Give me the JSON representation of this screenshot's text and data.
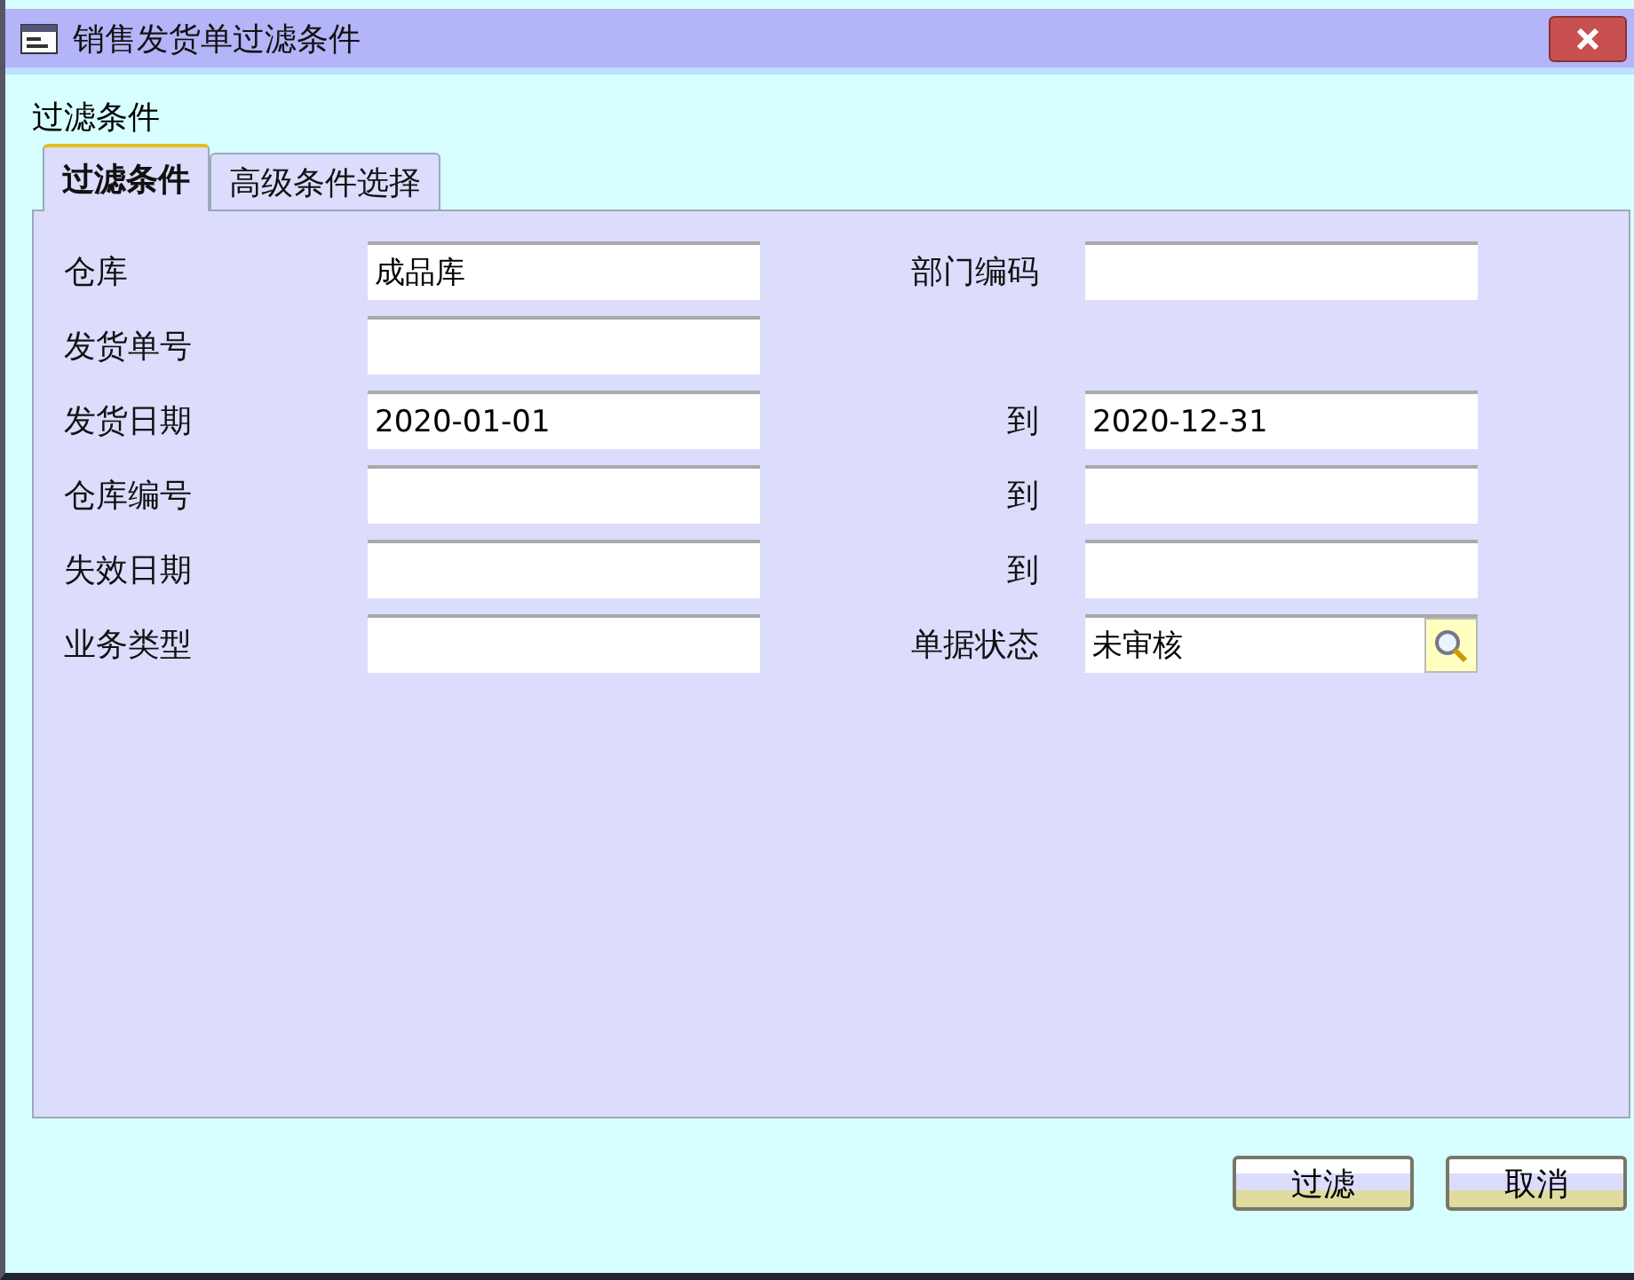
{
  "window": {
    "title": "销售发货单过滤条件"
  },
  "caption": "过滤条件",
  "tabs": [
    {
      "label": "过滤条件",
      "selected": true
    },
    {
      "label": "高级条件选择",
      "selected": false
    }
  ],
  "rows": [
    {
      "left": {
        "label": "仓库",
        "value": "成品库"
      },
      "right": {
        "label": "部门编码",
        "kind": "text"
      }
    },
    {
      "left": {
        "label": "发货单号"
      }
    },
    {
      "left": {
        "label": "发货日期",
        "value": "2020-01-01"
      },
      "right": {
        "label": "到",
        "value": "2020-12-31",
        "kind": "text"
      }
    },
    {
      "left": {
        "label": "仓库编号"
      },
      "right": {
        "label": "到",
        "kind": "text"
      }
    },
    {
      "left": {
        "label": "失效日期"
      },
      "right": {
        "label": "到",
        "kind": "text"
      }
    },
    {
      "left": {
        "label": "业务类型"
      },
      "right": {
        "label": "单据状态",
        "value": "未审核",
        "kind": "lookup"
      }
    }
  ],
  "buttons": [
    "过滤",
    "取消"
  ]
}
